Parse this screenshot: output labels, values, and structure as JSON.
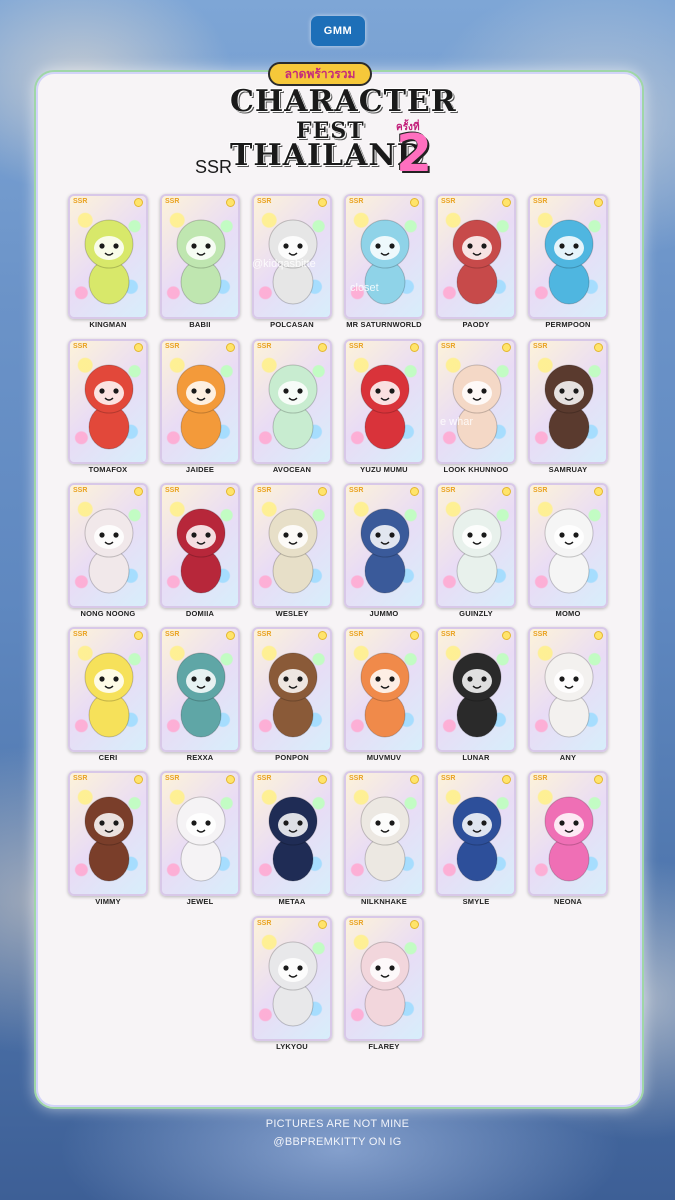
{
  "header": {
    "network_logo": "GMM",
    "brand_thai": "ลาดพร้าวรวม",
    "title_line1": "CHARACTER",
    "title_line2": "FEST",
    "title_line3": "THAILAND",
    "title_edition_thai": "ครั้งที่",
    "title_number": "2",
    "rarity": "SSR"
  },
  "card_rarity_tag": "SSR",
  "watermarks": [
    "@kidqasbitte",
    "closet",
    "e whar"
  ],
  "characters": [
    {
      "name": "KINGMAN",
      "color": "#d8e86a"
    },
    {
      "name": "BABII",
      "color": "#bfe6b0"
    },
    {
      "name": "POLCASAN",
      "color": "#e6e6e6"
    },
    {
      "name": "MR SATURNWORLD",
      "color": "#8fd3e8"
    },
    {
      "name": "PAODY",
      "color": "#c74a4a"
    },
    {
      "name": "PERMPOON",
      "color": "#4fb6e0"
    },
    {
      "name": "TOMAFOX",
      "color": "#e2483a"
    },
    {
      "name": "JAIDEE",
      "color": "#f39a3a"
    },
    {
      "name": "AVOCEAN",
      "color": "#c8ecd0"
    },
    {
      "name": "YUZU MUMU",
      "color": "#d9333a"
    },
    {
      "name": "LOOK KHUNNOO",
      "color": "#f4d8c6"
    },
    {
      "name": "SAMRUAY",
      "color": "#5a3a2e"
    },
    {
      "name": "NONG NOONG",
      "color": "#f1e8ea"
    },
    {
      "name": "DOMIIA",
      "color": "#b7273a"
    },
    {
      "name": "WESLEY",
      "color": "#e7dfc8"
    },
    {
      "name": "JUMMO",
      "color": "#3a5a9a"
    },
    {
      "name": "GUINZLY",
      "color": "#e8f1ec"
    },
    {
      "name": "MOMO",
      "color": "#f5f5f5"
    },
    {
      "name": "CERI",
      "color": "#f6e15a"
    },
    {
      "name": "REXXA",
      "color": "#5fa6a6"
    },
    {
      "name": "PONPON",
      "color": "#8a5a38"
    },
    {
      "name": "MUVMUV",
      "color": "#f08a4a"
    },
    {
      "name": "LUNAR",
      "color": "#2a2a2a"
    },
    {
      "name": "ANY",
      "color": "#f3f1ef"
    },
    {
      "name": "VIMMY",
      "color": "#7a3e2a"
    },
    {
      "name": "JEWEL",
      "color": "#f5f3f5"
    },
    {
      "name": "METAA",
      "color": "#1f2c55"
    },
    {
      "name": "NILKNHAKE",
      "color": "#ece8e2"
    },
    {
      "name": "SMYLE",
      "color": "#2d4f9a"
    },
    {
      "name": "NEONA",
      "color": "#ef6fb5"
    },
    {
      "name": "LYKYOU",
      "color": "#e8e8ea"
    },
    {
      "name": "FLAREY",
      "color": "#f2d6dc"
    }
  ],
  "footer": {
    "line1": "PICTURES ARE NOT MINE",
    "line2": "@BBPREMKITTY ON IG"
  },
  "colors": {
    "panel_border": "#9fd6a7",
    "panel_bg": "#f7f4f6",
    "title_number": "#ff6fbf"
  }
}
